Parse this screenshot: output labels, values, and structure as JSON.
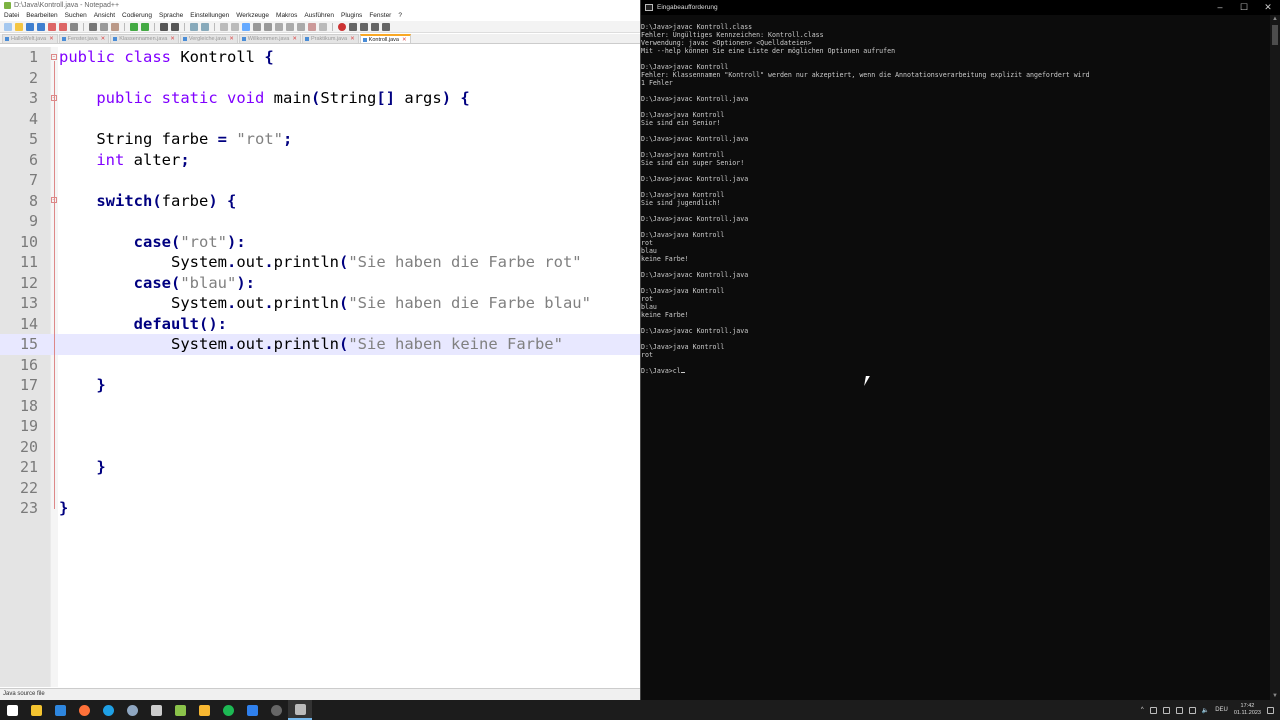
{
  "npp": {
    "title": "D:\\Java\\Kontroll.java - Notepad++",
    "menu": [
      "Datei",
      "Bearbeiten",
      "Suchen",
      "Ansicht",
      "Codierung",
      "Sprache",
      "Einstellungen",
      "Werkzeuge",
      "Makros",
      "Ausführen",
      "Plugins",
      "Fenster",
      "?"
    ],
    "tabs": [
      {
        "label": "HalloWelt.java",
        "active": false
      },
      {
        "label": "Fenster.java",
        "active": false
      },
      {
        "label": "Klassennamen.java",
        "active": false
      },
      {
        "label": "Vergleiche.java",
        "active": false
      },
      {
        "label": "Willkommen.java",
        "active": false
      },
      {
        "label": "Praktikum.java",
        "active": false
      },
      {
        "label": "Kontroll.java",
        "active": true
      }
    ],
    "status_text": "Java source file",
    "current_line": 15,
    "code_lines": [
      {
        "n": "1",
        "segs": [
          [
            "kw",
            "public"
          ],
          [
            "t",
            " "
          ],
          [
            "kw",
            "class"
          ],
          [
            "t",
            " Kontroll "
          ],
          [
            "op",
            "{"
          ]
        ]
      },
      {
        "n": "2",
        "segs": []
      },
      {
        "n": "3",
        "segs": [
          [
            "t",
            "    "
          ],
          [
            "kw",
            "public"
          ],
          [
            "t",
            " "
          ],
          [
            "kw",
            "static"
          ],
          [
            "t",
            " "
          ],
          [
            "kw",
            "void"
          ],
          [
            "t",
            " main"
          ],
          [
            "op",
            "("
          ],
          [
            "t",
            "String"
          ],
          [
            "op",
            "[]"
          ],
          [
            "t",
            " args"
          ],
          [
            "op",
            ")"
          ],
          [
            "t",
            " "
          ],
          [
            "op",
            "{"
          ]
        ]
      },
      {
        "n": "4",
        "segs": []
      },
      {
        "n": "5",
        "segs": [
          [
            "t",
            "    String farbe "
          ],
          [
            "op",
            "="
          ],
          [
            "t",
            " "
          ],
          [
            "str",
            "\"rot\""
          ],
          [
            "op",
            ";"
          ]
        ]
      },
      {
        "n": "6",
        "segs": [
          [
            "t",
            "    "
          ],
          [
            "kw",
            "int"
          ],
          [
            "t",
            " alter"
          ],
          [
            "op",
            ";"
          ]
        ]
      },
      {
        "n": "7",
        "segs": []
      },
      {
        "n": "8",
        "segs": [
          [
            "t",
            "    "
          ],
          [
            "kwb",
            "switch"
          ],
          [
            "op",
            "("
          ],
          [
            "t",
            "farbe"
          ],
          [
            "op",
            ")"
          ],
          [
            "t",
            " "
          ],
          [
            "op",
            "{"
          ]
        ]
      },
      {
        "n": "9",
        "segs": []
      },
      {
        "n": "10",
        "segs": [
          [
            "t",
            "        "
          ],
          [
            "kwb",
            "case"
          ],
          [
            "op",
            "("
          ],
          [
            "str",
            "\"rot\""
          ],
          [
            "op",
            "):"
          ]
        ]
      },
      {
        "n": "11",
        "segs": [
          [
            "t",
            "            System"
          ],
          [
            "op",
            "."
          ],
          [
            "t",
            "out"
          ],
          [
            "op",
            "."
          ],
          [
            "t",
            "println"
          ],
          [
            "op",
            "("
          ],
          [
            "str",
            "\"Sie haben die Farbe rot\""
          ]
        ]
      },
      {
        "n": "12",
        "segs": [
          [
            "t",
            "        "
          ],
          [
            "kwb",
            "case"
          ],
          [
            "op",
            "("
          ],
          [
            "str",
            "\"blau\""
          ],
          [
            "op",
            "):"
          ]
        ]
      },
      {
        "n": "13",
        "segs": [
          [
            "t",
            "            System"
          ],
          [
            "op",
            "."
          ],
          [
            "t",
            "out"
          ],
          [
            "op",
            "."
          ],
          [
            "t",
            "println"
          ],
          [
            "op",
            "("
          ],
          [
            "str",
            "\"Sie haben die Farbe blau\""
          ]
        ]
      },
      {
        "n": "14",
        "segs": [
          [
            "t",
            "        "
          ],
          [
            "kwb",
            "default"
          ],
          [
            "op",
            "():"
          ]
        ]
      },
      {
        "n": "15",
        "segs": [
          [
            "t",
            "            System"
          ],
          [
            "op",
            "."
          ],
          [
            "t",
            "out"
          ],
          [
            "op",
            "."
          ],
          [
            "t",
            "println"
          ],
          [
            "op",
            "("
          ],
          [
            "str",
            "\"Sie haben keine Farbe\""
          ]
        ]
      },
      {
        "n": "16",
        "segs": []
      },
      {
        "n": "17",
        "segs": [
          [
            "t",
            "    "
          ],
          [
            "op",
            "}"
          ]
        ]
      },
      {
        "n": "18",
        "segs": []
      },
      {
        "n": "19",
        "segs": []
      },
      {
        "n": "20",
        "segs": []
      },
      {
        "n": "21",
        "segs": [
          [
            "t",
            "    "
          ],
          [
            "op",
            "}"
          ]
        ]
      },
      {
        "n": "22",
        "segs": []
      },
      {
        "n": "23",
        "segs": [
          [
            "op",
            "}"
          ]
        ]
      }
    ]
  },
  "cmd": {
    "title": "Eingabeaufforderung",
    "lines": [
      "D:\\Java>javac Kontroll.class",
      "Fehler: Ungültiges Kennzeichen: Kontroll.class",
      "Verwendung: javac <Optionen> <Quelldateien>",
      "Mit --help können Sie eine Liste der möglichen Optionen aufrufen",
      "",
      "D:\\Java>javac Kontroll",
      "Fehler: Klassennamen \"Kontroll\" werden nur akzeptiert, wenn die Annotationsverarbeitung explizit angefordert wird",
      "1 Fehler",
      "",
      "D:\\Java>javac Kontroll.java",
      "",
      "D:\\Java>java Kontroll",
      "Sie sind ein Senior!",
      "",
      "D:\\Java>javac Kontroll.java",
      "",
      "D:\\Java>java Kontroll",
      "Sie sind ein super Senior!",
      "",
      "D:\\Java>javac Kontroll.java",
      "",
      "D:\\Java>java Kontroll",
      "Sie sind jugendlich!",
      "",
      "D:\\Java>javac Kontroll.java",
      "",
      "D:\\Java>java Kontroll",
      "rot",
      "blau",
      "keine Farbe!",
      "",
      "D:\\Java>javac Kontroll.java",
      "",
      "D:\\Java>java Kontroll",
      "rot",
      "blau",
      "keine Farbe!",
      "",
      "D:\\Java>javac Kontroll.java",
      "",
      "D:\\Java>java Kontroll",
      "rot",
      ""
    ],
    "prompt_input": "D:\\Java>cl"
  },
  "taskbar": {
    "icons": [
      {
        "name": "start-icon",
        "color": "#ffffff"
      },
      {
        "name": "file-explorer-icon",
        "color": "#f4c430"
      },
      {
        "name": "mail-icon",
        "color": "#2e86de"
      },
      {
        "name": "firefox-icon",
        "color": "#ff7139"
      },
      {
        "name": "edge-icon",
        "color": "#1fa0e5"
      },
      {
        "name": "steam-icon",
        "color": "#8fa7c2"
      },
      {
        "name": "explorer-icon",
        "color": "#cccccc"
      },
      {
        "name": "notepadpp-icon",
        "color": "#8bc34a"
      },
      {
        "name": "paint-icon",
        "color": "#f7b731"
      },
      {
        "name": "spotify-icon",
        "color": "#1db954"
      },
      {
        "name": "vscode-icon",
        "color": "#2f80ed"
      },
      {
        "name": "obs-icon",
        "color": "#666666"
      },
      {
        "name": "cmd-icon",
        "color": "#bbbbbb"
      }
    ],
    "language": "DEU",
    "time": "17:42",
    "date": "01.11.2023"
  }
}
